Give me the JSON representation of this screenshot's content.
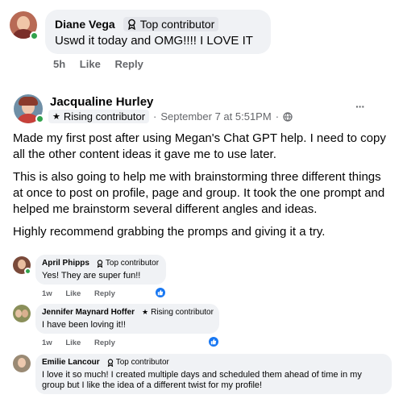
{
  "top_comment": {
    "author": "Diane Vega",
    "badge": "Top contributor",
    "text": "Uswd it today and OMG!!!! I LOVE IT",
    "time": "5h",
    "like_label": "Like",
    "reply_label": "Reply"
  },
  "post": {
    "author": "Jacqualine Hurley",
    "badge": "Rising contributor",
    "date": "September 7 at 5:51PM",
    "separator": "·",
    "more_label": "···",
    "paragraphs": [
      "Made my first post after using Megan's Chat GPT help. I need to copy all the other content ideas it gave me to use later.",
      "This is also going to help me with brainstorming three different things at once to post on profile, page and group.  It took the one prompt and helped me brainstorm several different angles and ideas.",
      "Highly recommend grabbing the promps and giving it a try."
    ]
  },
  "comments": [
    {
      "author": "April Phipps",
      "badge": "Top contributor",
      "text": "Yes! They are super fun!!",
      "time": "1w",
      "like_label": "Like",
      "reply_label": "Reply"
    },
    {
      "author": "Jennifer Maynard Hoffer",
      "badge": "Rising contributor",
      "text": "I have been loving it!!",
      "time": "1w",
      "like_label": "Like",
      "reply_label": "Reply"
    },
    {
      "author": "Emilie Lancour",
      "badge": "Top contributor",
      "text": "I love it so much! I created multiple days and scheduled them ahead of time in my group but I like the idea of a different twist for my profile!",
      "time": "",
      "like_label": "",
      "reply_label": ""
    }
  ],
  "colors": {
    "bubble": "#f0f2f5",
    "meta": "#65676b",
    "online": "#31a24c",
    "like": "#1877f2"
  },
  "icons": {
    "top_contributor": "award-ribbon-icon",
    "rising_contributor": "star-icon",
    "audience": "globe-icon",
    "reaction": "thumbs-up-icon",
    "more": "more-dots-icon"
  }
}
